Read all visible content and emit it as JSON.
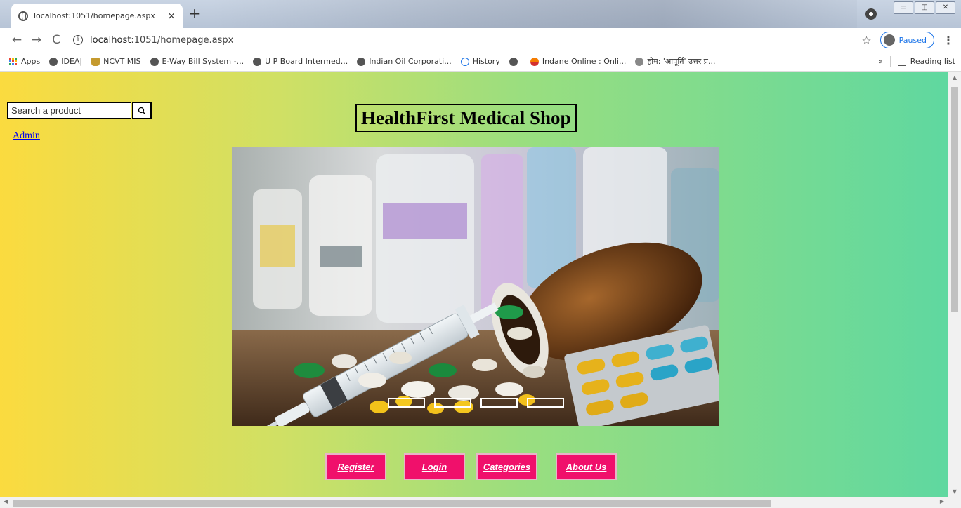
{
  "browser": {
    "tab_title": "localhost:1051/homepage.aspx",
    "tab_close": "×",
    "new_tab": "+",
    "url_host": "localhost",
    "url_rest": ":1051/homepage.aspx",
    "profile_status": "Paused",
    "bookmarks": [
      {
        "label": "Apps",
        "icon": "apps-icon"
      },
      {
        "label": "IDEA|",
        "icon": "globe-icon"
      },
      {
        "label": "NCVT MIS",
        "icon": "emblem-icon"
      },
      {
        "label": "E-Way Bill System -...",
        "icon": "globe-icon"
      },
      {
        "label": "U P Board Intermed...",
        "icon": "globe-icon"
      },
      {
        "label": "Indian Oil Corporati...",
        "icon": "globe-icon"
      },
      {
        "label": "History",
        "icon": "history-icon"
      },
      {
        "label": "",
        "icon": "globe-icon"
      },
      {
        "label": "Indane Online : Onli...",
        "icon": "indane-icon"
      },
      {
        "label": "होम: 'आपूर्ति' उत्तर प्र...",
        "icon": "flower-icon"
      }
    ],
    "more_bookmarks": "»",
    "reading_list": "Reading list"
  },
  "page": {
    "search_placeholder": "Search a product",
    "admin_link": "Admin",
    "title": "HealthFirst Medical Shop",
    "slider_indicator_count": 4,
    "nav_buttons": [
      {
        "label": "Register"
      },
      {
        "label": "Login"
      },
      {
        "label": "Categories"
      },
      {
        "label": "About Us"
      }
    ]
  },
  "colors": {
    "gradient_left": "#fbdb3f",
    "gradient_right": "#5fd8a0",
    "button_bg": "#f0106b",
    "link": "#0000ee"
  }
}
